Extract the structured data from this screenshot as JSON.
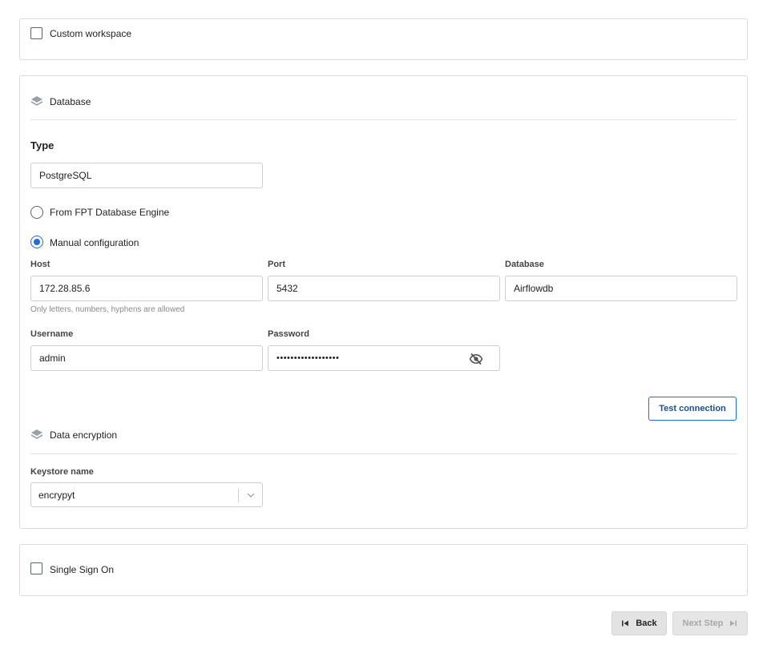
{
  "custom_workspace": {
    "label": "Custom workspace",
    "checked": false
  },
  "database_section": {
    "title": "Database",
    "icon": "layers-icon",
    "type_label": "Type",
    "type_value": "PostgreSQL",
    "options": {
      "from_engine": {
        "label": "From FPT Database Engine",
        "selected": false
      },
      "manual": {
        "label": "Manual configuration",
        "selected": true
      }
    },
    "host": {
      "label": "Host",
      "value": "172.28.85.6",
      "hint": "Only letters, numbers, hyphens are allowed"
    },
    "port": {
      "label": "Port",
      "value": "5432"
    },
    "database": {
      "label": "Database",
      "value": "Airflowdb"
    },
    "username": {
      "label": "Username",
      "value": "admin"
    },
    "password": {
      "label": "Password",
      "masked_value": "••••••••••••••••••",
      "icon": "eye-slash-icon"
    },
    "test_connection_label": "Test connection"
  },
  "encryption_section": {
    "title": "Data encryption",
    "icon": "layers-icon",
    "keystore_label": "Keystore name",
    "keystore_value": "encrypyt",
    "keystore_icon": "chevron-down-icon"
  },
  "sso": {
    "label": "Single Sign On",
    "checked": false
  },
  "footer": {
    "back_label": "Back",
    "back_icon": "skip-back-icon",
    "next_label": "Next Step",
    "next_icon": "skip-forward-icon",
    "next_disabled": true
  },
  "colors": {
    "accent": "#1e6fd9",
    "border": "#dcdcdc",
    "disabled_text": "#a8a8a8"
  }
}
